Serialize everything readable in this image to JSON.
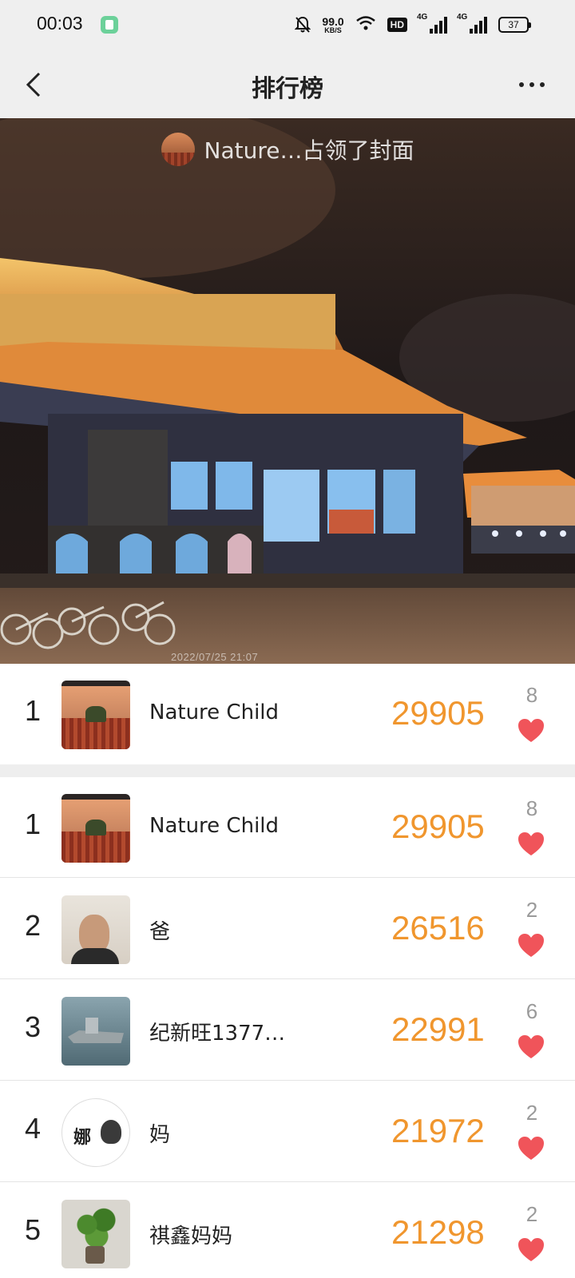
{
  "status_bar": {
    "time": "00:03",
    "net_speed_value": "99.0",
    "net_speed_unit": "KB/S",
    "hd_label": "HD",
    "signal_1_label": "4G",
    "signal_2_label": "4G",
    "battery_level": "37",
    "icons": [
      "app-notification-icon",
      "bell-muted-icon",
      "wifi-icon",
      "hd-icon",
      "signal-icon",
      "battery-icon"
    ]
  },
  "nav": {
    "title": "排行榜",
    "icons": [
      "back-arrow-icon",
      "more-dots-icon"
    ]
  },
  "cover": {
    "caption": "Nature…占领了封面",
    "timestamp": "2022/07/25 21:07"
  },
  "featured": {
    "rank": "1",
    "name": "Nature Child",
    "score": "29905",
    "likes": "8"
  },
  "rankings": [
    {
      "rank": "1",
      "name": "Nature Child",
      "score": "29905",
      "likes": "8"
    },
    {
      "rank": "2",
      "name": "爸",
      "score": "26516",
      "likes": "2"
    },
    {
      "rank": "3",
      "name": "纪新旺1377…",
      "score": "22991",
      "likes": "6"
    },
    {
      "rank": "4",
      "name": "妈",
      "score": "21972",
      "likes": "2"
    },
    {
      "rank": "5",
      "name": "祺鑫妈妈",
      "score": "21298",
      "likes": "2"
    }
  ],
  "colors": {
    "score": "#f0962e",
    "heart": "#f0545a",
    "bar_bg": "#efefef"
  }
}
